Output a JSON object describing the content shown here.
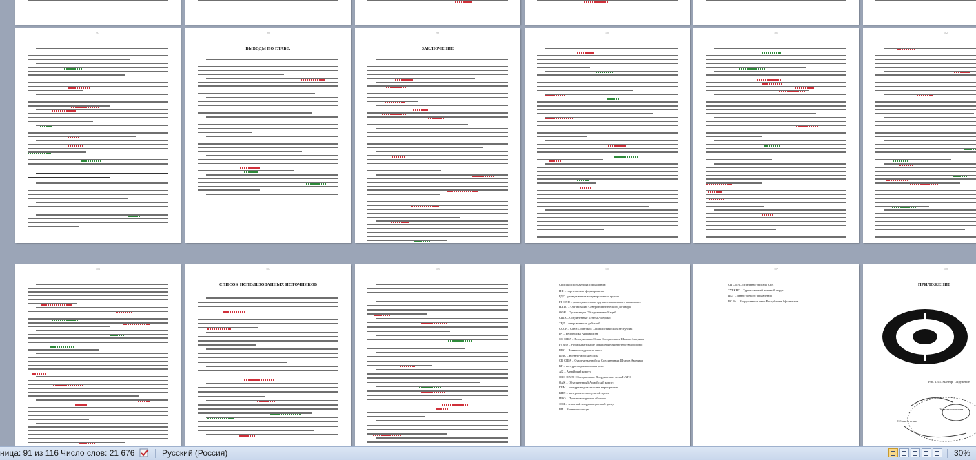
{
  "document": {
    "page_headings": {
      "conclusions_chapter_one": "ВЫВОДЫ ПО ГЛАВЕ.",
      "conclusion": "ЗАКЛЮЧЕНИЕ",
      "references": "СПИСОК ИСПОЛЬЗОВАННЫХ ИСТОЧНИКОВ",
      "appendix": "ПРИЛОЖЕНИЕ"
    },
    "page_numbers": [
      "97",
      "98",
      "99",
      "100",
      "101",
      "102",
      "103",
      "104",
      "105",
      "106",
      "107",
      "108"
    ],
    "snippets": {
      "p7_line1": "Основными путями совершенствования форм и методов ведения боевых действий разведывательных подразделений являются:",
      "p7_subhead": "Особенности обеспечения разведывательно-боевой деятельности частей и подразделений специального назначения",
      "p8_line1": "Данная глава включает в себя практические рекомендации по созданию партизанских формирований",
      "p9_line1": "В ходе выполнения дипломной работы по данной теме нами были сформулированы цели и задачи",
      "p13_line1": "Таким образом изучение данной темы, \"Тактика ведения малых войн\" является актуальной темой.",
      "p14_item1": "1. Алексей Особый род войск с позиции нелинейности [Электронный ресурс]. – Режим доступа",
      "p15_item11": "11. Подготовка РГ СпН (РО) к выполнению боевых задач (конспект) [Электронный ресурс] – Режим доступа",
      "p15_item12": "12. Полевой устав армии США FM 90-8 [Электронный ресурс] – Режим доступа",
      "p15_item13": "13. Руководство по ведению партизанской войны СССР Генеральный штаб РККА [Электронный ресурс] – Режим доступа",
      "p15_item14": "14. Тарас А.Е. «Малая война» [Электронный ресурс]. – Режим доступа",
      "p15_item15": "15. Энциклопедия безопасности [Электронный ресурс] – Режим доступа",
      "p16_title": "Список используемых сокращений:",
      "p16_items": [
        "ПФ – партизанские формирования",
        "РДГ – разведывательно-диверсионная группа",
        "РГ СПН – разведывательная группа специального назначения",
        "НАТО – Организация Североатлантического договора",
        "ООН – Организация Объединенных Наций",
        "США – Соединенные Штаты Америки",
        "ТВД – театр военных действий",
        "СССР – Союз Советских Социалистических Республик",
        "РА – Республика Афганистан",
        "СС США – Вооруженные Силы Соединенных Штатов Америки",
        "РУМО – Разведывательное управление Министерства обороны",
        "ВВС – Военно-воздушные силы",
        "ВМС – Военно-морские силы",
        "СВ США – Сухопутные войска Соединенных Штатов Америки",
        "КР – контрразведывательная рота",
        "АК – Армейский корпус",
        "ОВС НАТО Объединенные Вооруженные силы НАТО",
        "ОАК – Объединенный Армейский корпус",
        "КРМ – контрразведывательные мероприятия",
        "КПП – контрольно-пропускной пункт",
        "ПВО – Противовоздушная оборона",
        "ЗКЦ – зенитный координационный центр",
        "ВП – Военная полиция"
      ],
      "p17_items": [
        "СП СПН – отдельная бригада СпН",
        "ТУРКВО – Туркестанский военный округ",
        "ЦБУ – центр боевого управления",
        "ВС РА – Вооруженные силы Республики Афганистан"
      ],
      "p18_caption": "Рис. 2.3.1. Маневр \"Окружение\"",
      "p18_labels": [
        "Обязательная зона",
        "Объекты атаки"
      ]
    }
  },
  "statusbar": {
    "page": "ница: 91 из 116",
    "words": "Число слов: 21 676",
    "language": "Русский (Россия)",
    "zoom": "30%",
    "spellcheck_icon": "spellcheck-icon",
    "view_buttons": [
      "print-layout",
      "full-screen-reading",
      "web-layout",
      "outline",
      "draft"
    ]
  },
  "colors": {
    "workspace": "#9ba5b7",
    "statusbar": "#d3dfef",
    "spell_error": "#d0303a",
    "grammar_error": "#2e8b3a"
  }
}
